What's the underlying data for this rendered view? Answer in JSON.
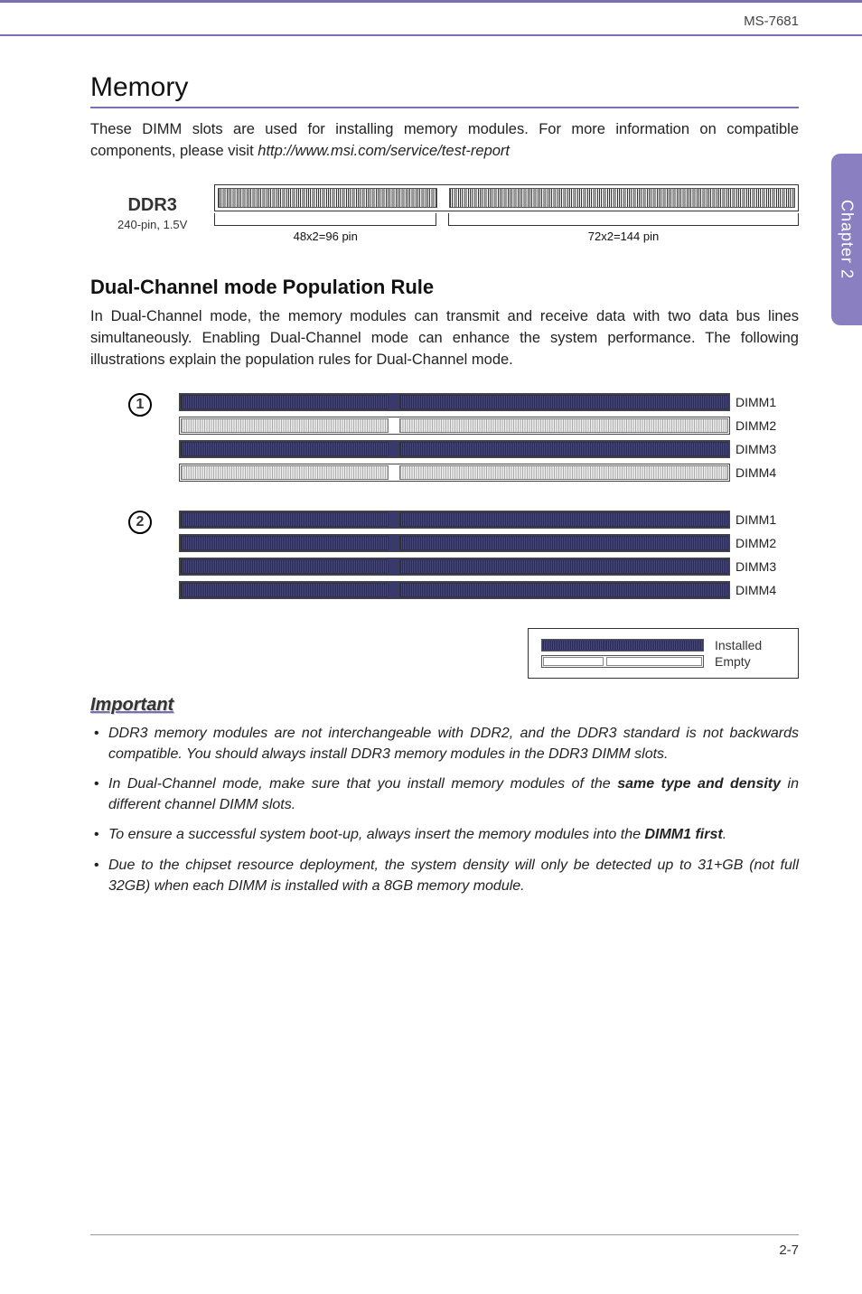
{
  "header": {
    "doc_id": "MS-7681"
  },
  "side_tab": "Chapter 2",
  "memory": {
    "title": "Memory",
    "intro_a": "These DIMM slots are used for installing memory modules. For more information on compatible components, please visit ",
    "intro_link": "http://www.msi.com/service/test-report",
    "ddr": {
      "label_big": "DDR3",
      "label_small": "240-pin, 1.5V",
      "pin_left": "48x2=96 pin",
      "pin_right": "72x2=144  pin"
    }
  },
  "dual": {
    "title": "Dual-Channel mode Population Rule",
    "para": "In Dual-Channel mode, the memory modules can transmit and receive data with two data bus lines simultaneously. Enabling Dual-Channel mode can enhance the system performance. The following illustrations explain the population rules for Dual-Channel mode.",
    "sets": [
      {
        "num": "1",
        "slots": [
          {
            "label": "DIMM1",
            "filled": true
          },
          {
            "label": "DIMM2",
            "filled": false
          },
          {
            "label": "DIMM3",
            "filled": true
          },
          {
            "label": "DIMM4",
            "filled": false
          }
        ]
      },
      {
        "num": "2",
        "slots": [
          {
            "label": "DIMM1",
            "filled": true
          },
          {
            "label": "DIMM2",
            "filled": true
          },
          {
            "label": "DIMM3",
            "filled": true
          },
          {
            "label": "DIMM4",
            "filled": true
          }
        ]
      }
    ],
    "legend": {
      "installed": "Installed",
      "empty": "Empty"
    }
  },
  "important": {
    "heading": "Important",
    "notes": [
      {
        "pre": "DDR3 memory modules are not interchangeable with DDR2, and the DDR3 standard is not backwards compatible. You should always install DDR3 memory modules in the DDR3 DIMM slots."
      },
      {
        "pre": "In Dual-Channel mode, make sure that you install memory modules of the ",
        "em": "same type and density",
        "post": " in different channel DIMM slots."
      },
      {
        "pre": "To ensure a successful system boot-up, always insert the memory modules into the ",
        "em": "DIMM1 first",
        "post": "."
      },
      {
        "pre": "Due to the chipset resource deployment, the system density will only be detected up to 31+GB (not full 32GB) when each DIMM is installed with a 8GB memory module."
      }
    ]
  },
  "footer": {
    "page": "2-7"
  }
}
